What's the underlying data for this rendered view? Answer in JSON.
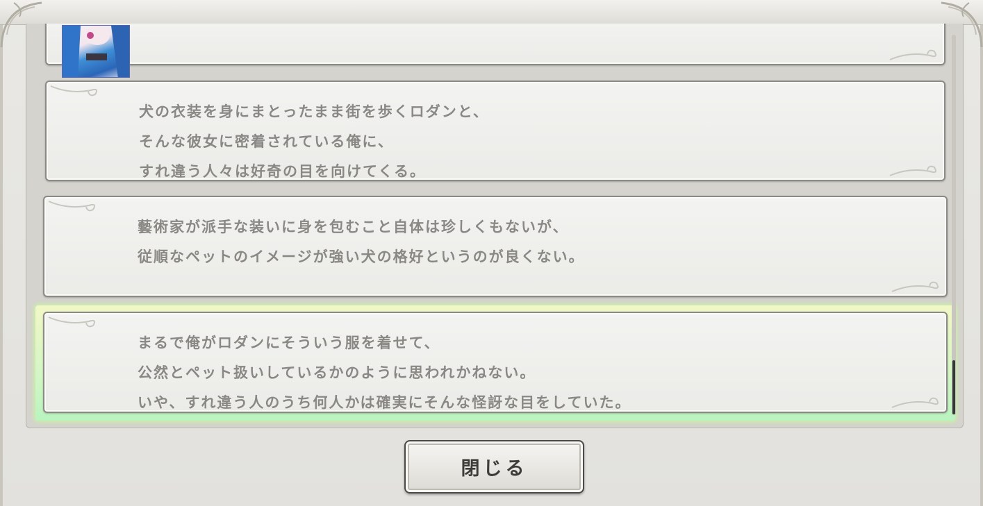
{
  "backlog": {
    "entries": [
      {
        "lines": []
      },
      {
        "lines": [
          "犬の衣装を身にまとったまま街を歩くロダンと、",
          "そんな彼女に密着されている俺に、",
          "すれ違う人々は好奇の目を向けてくる。"
        ]
      },
      {
        "lines": [
          "藝術家が派手な装いに身を包むこと自体は珍しくもないが、",
          "従順なペットのイメージが強い犬の格好というのが良くない。"
        ]
      },
      {
        "lines": [
          "まるで俺がロダンにそういう服を着せて、",
          "公然とペット扱いしているかのように思われかねない。",
          "いや、すれ違う人のうち何人かは確実にそんな怪訝な目をしていた。"
        ]
      }
    ],
    "selected_index": 3,
    "first_entry_icons": [
      "character-portrait-icon",
      "voice-replay-icon"
    ]
  },
  "footer": {
    "close_label": "閉じる"
  },
  "colors": {
    "text": "#8a8884",
    "highlight": "#c8f5b0",
    "frame": "#e4e3df"
  }
}
